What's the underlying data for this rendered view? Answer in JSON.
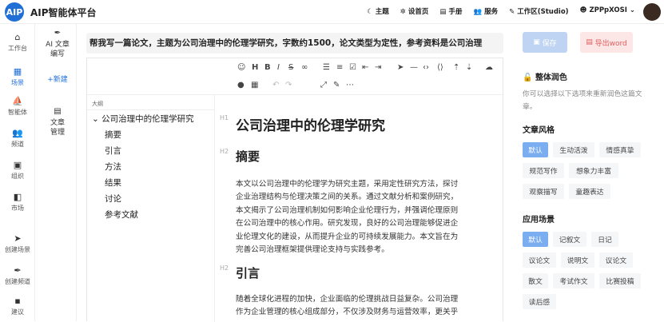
{
  "app": {
    "logo_text": "AIP",
    "title": "AIP智能体平台"
  },
  "topnav": [
    {
      "icon": "moon-icon",
      "glyph": "☾",
      "label": "主题"
    },
    {
      "icon": "settings-icon",
      "glyph": "✲",
      "label": "设首页"
    },
    {
      "icon": "book-icon",
      "glyph": "▤",
      "label": "手册"
    },
    {
      "icon": "users-icon",
      "glyph": "👥",
      "label": "服务"
    },
    {
      "icon": "pen-icon",
      "glyph": "✎",
      "label": "工作区(Studio)"
    },
    {
      "icon": "user-icon",
      "glyph": "☻",
      "label": "ZPPpXOSI ⌄"
    }
  ],
  "leftnav": [
    {
      "icon": "home-icon",
      "glyph": "⌂",
      "label": "工作台"
    },
    {
      "icon": "plaza-icon",
      "glyph": "▦",
      "label": "场景"
    },
    {
      "icon": "agent-icon",
      "glyph": "⛵",
      "label": "智能体"
    },
    {
      "icon": "channel-icon",
      "glyph": "👥",
      "label": "频道"
    },
    {
      "icon": "org-icon",
      "glyph": "▣",
      "label": "组织"
    },
    {
      "icon": "market-icon",
      "glyph": "◧",
      "label": "市场"
    },
    {
      "icon": "create-scene-icon",
      "glyph": "➤",
      "label": "创建场景"
    },
    {
      "icon": "create-channel-icon",
      "glyph": "✒",
      "label": "创建频道"
    },
    {
      "icon": "suggest-icon",
      "glyph": "▪",
      "label": "建议"
    }
  ],
  "col2": {
    "ai_write": {
      "glyph": "✒",
      "label1": "AI 文章",
      "label2": "编写"
    },
    "new_label": "+新建",
    "manage": {
      "glyph": "▤",
      "label1": "文章",
      "label2": "管理"
    }
  },
  "prompt": "帮我写一篇论文，主题为公司治理中的伦理学研究，字数约1500，论文类型为定性，参考资料是公司治理",
  "outline": {
    "header": "大纲",
    "root": "公司治理中的伦理学研究",
    "items": [
      "摘要",
      "引言",
      "方法",
      "结果",
      "讨论",
      "参考文献"
    ]
  },
  "doc": {
    "h1_marker": "H1",
    "title": "公司治理中的伦理学研究",
    "sections": [
      {
        "marker": "H2",
        "heading": "摘要",
        "lines": [
          "本文以公司治理中的伦理学为研究主题，采用定性研究方法，探讨",
          "企业治理结构与伦理决策之间的关系。通过文献分析和案例研究，",
          "本文揭示了公司治理机制如何影响企业伦理行为，并强调伦理原则",
          "在公司治理中的核心作用。研究发现，良好的公司治理能够促进企",
          "业伦理文化的建设，从而提升企业的可持续发展能力。本文旨在为",
          "完善公司治理框架提供理论支持与实践参考。"
        ]
      },
      {
        "marker": "H2",
        "heading": "引言",
        "lines": [
          "随着全球化进程的加快，企业面临的伦理挑战日益复杂。公司治理",
          "作为企业管理的核心组成部分，不仅涉及财务与运营效率，更关乎"
        ]
      }
    ]
  },
  "right": {
    "save": "保存",
    "export": "导出word",
    "overall_title": "整体润色",
    "overall_desc": [
      "你可以选择以下选项来重新润色这篇文",
      "章。"
    ],
    "style_title": "文章风格",
    "styles": [
      "默认",
      "生动活泼",
      "情感真挚",
      "规范写作",
      "想象力丰富",
      "观察描写",
      "童趣表达"
    ],
    "scene_title": "应用场景",
    "scenes": [
      "默认",
      "记叙文",
      "日记",
      "议论文",
      "说明文",
      "议论文",
      "散文",
      "考试作文",
      "比赛投稿",
      "读后感"
    ]
  }
}
